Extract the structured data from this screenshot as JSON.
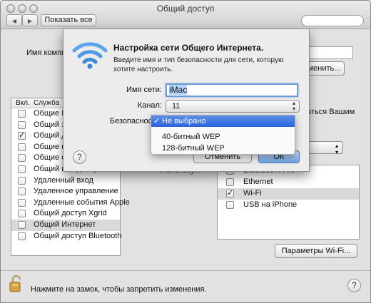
{
  "window": {
    "title": "Общий доступ",
    "show_all_label": "Показать все",
    "back_glyph": "◀",
    "forward_glyph": "▶"
  },
  "background": {
    "computer_name_label": "Имя компь",
    "edit_button_fragment": "зменить...",
    "sharing_fragment": "заться Вашим",
    "ports_label": "Используя:",
    "wifi_options_label": "Параметры Wi-Fi...",
    "lock_text": "Нажмите на замок, чтобы запретить изменения.",
    "help_glyph": "?"
  },
  "services": {
    "header": {
      "on": "Вкл.",
      "service": "Служба"
    },
    "rows": [
      {
        "name": "Общие DVD или CD",
        "checked": false,
        "selected": false
      },
      {
        "name": "Общий экран",
        "checked": false,
        "selected": false
      },
      {
        "name": "Общий доступ к файлам",
        "checked": true,
        "selected": false
      },
      {
        "name": "Общие принтеры",
        "checked": false,
        "selected": false
      },
      {
        "name": "Общие сканеры",
        "checked": false,
        "selected": false
      },
      {
        "name": "Общий веб-доступ",
        "checked": false,
        "selected": false
      },
      {
        "name": "Удаленный вход",
        "checked": false,
        "selected": false
      },
      {
        "name": "Удаленное управление",
        "checked": false,
        "selected": false
      },
      {
        "name": "Удаленные события Apple",
        "checked": false,
        "selected": false
      },
      {
        "name": "Общий доступ Xgrid",
        "checked": false,
        "selected": false
      },
      {
        "name": "Общий Интернет",
        "checked": false,
        "selected": true
      },
      {
        "name": "Общий доступ Bluetooth",
        "checked": false,
        "selected": false
      }
    ]
  },
  "ports": [
    {
      "name": "Bluetooth PAN",
      "checked": false,
      "selected": false
    },
    {
      "name": "Ethernet",
      "checked": false,
      "selected": false
    },
    {
      "name": "Wi-Fi",
      "checked": true,
      "selected": true
    },
    {
      "name": "USB на iPhone",
      "checked": false,
      "selected": false
    }
  ],
  "sheet": {
    "title": "Настройка сети Общего Интернета.",
    "description": "Введите имя и тип безопасности для сети, которую хотите настроить.",
    "network_name_label": "Имя сети:",
    "network_name_value": "iMac",
    "channel_label": "Канал:",
    "channel_value": "11",
    "security_label": "Безопасность:",
    "cancel_label": "Отменить",
    "ok_label": "ОК",
    "help_glyph": "?"
  },
  "security_menu": {
    "items": [
      {
        "label": "Не выбрано",
        "selected": true
      },
      {
        "label": "40-битный WEP",
        "selected": false
      },
      {
        "label": "128-битный WEP",
        "selected": false
      }
    ]
  },
  "colors": {
    "accent": "#2a64de",
    "wifi_icon": "#4f9be8"
  }
}
